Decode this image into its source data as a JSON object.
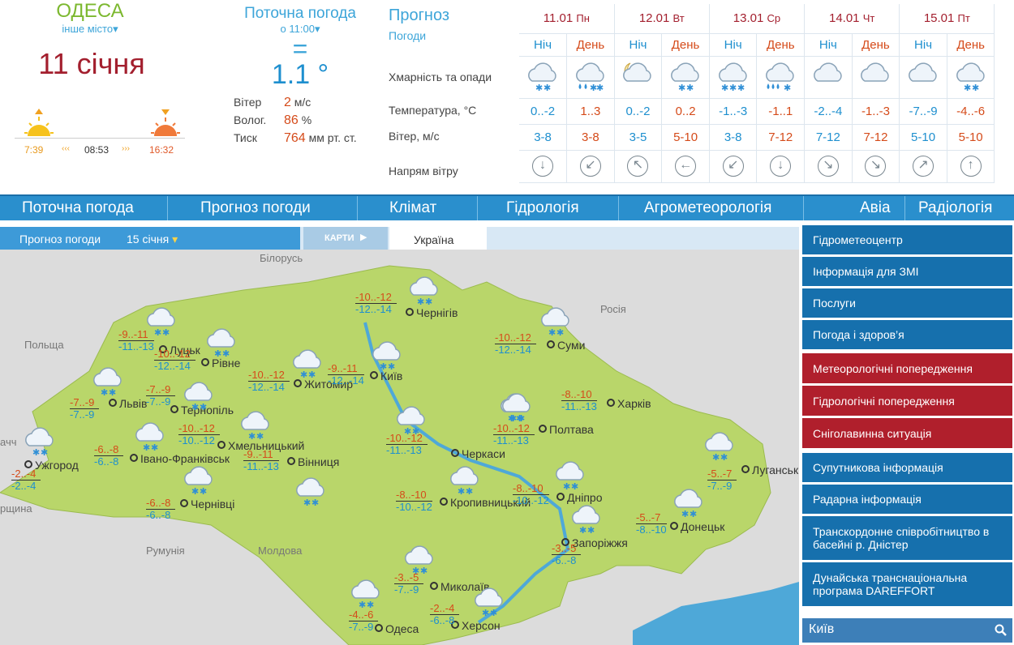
{
  "city": {
    "name": "ОДЕСА",
    "other": "інше місто",
    "date": "11 січня"
  },
  "sun": {
    "rise": "7:39",
    "length": "08:53",
    "set": "16:32"
  },
  "current": {
    "title": "Поточна погода",
    "time": "о 11:00",
    "trend": "=",
    "temp": "1.1 °",
    "wind": {
      "label": "Вітер",
      "value": "2",
      "unit": "м/с"
    },
    "humidity": {
      "label": "Волог.",
      "value": "86",
      "unit": "%"
    },
    "pressure": {
      "label": "Тиск",
      "value": "764",
      "unit": "мм рт. ст."
    }
  },
  "forecast": {
    "title": "Прогноз",
    "subtitle": "Погоди",
    "row_labels": [
      "Хмарність та опади",
      "Температура, °C",
      "Вітер, м/с",
      "Напрям вітру"
    ],
    "night_label": "Ніч",
    "day_label": "День",
    "days": [
      {
        "date": "11.01",
        "dow": "Пн",
        "cols": [
          {
            "temp": "0..-2",
            "wind": "3-8",
            "icon": "cloud-snow-icon",
            "dir": "↓"
          },
          {
            "temp": "1..3",
            "wind": "3-8",
            "icon": "cloud-rain-snow-icon",
            "dir": "↙"
          }
        ]
      },
      {
        "date": "12.01",
        "dow": "Вт",
        "cols": [
          {
            "temp": "0..-2",
            "wind": "3-5",
            "icon": "moon-cloud-icon",
            "dir": "↖"
          },
          {
            "temp": "0..2",
            "wind": "5-10",
            "icon": "cloud-snow-icon",
            "dir": "←"
          }
        ]
      },
      {
        "date": "13.01",
        "dow": "Ср",
        "cols": [
          {
            "temp": "-1..-3",
            "wind": "3-8",
            "icon": "cloud-heavy-snow-icon",
            "dir": "↙"
          },
          {
            "temp": "-1..1",
            "wind": "7-12",
            "icon": "cloud-heavy-rain-snow-icon",
            "dir": "↓"
          }
        ]
      },
      {
        "date": "14.01",
        "dow": "Чт",
        "cols": [
          {
            "temp": "-2..-4",
            "wind": "7-12",
            "icon": "cloud-icon",
            "dir": "↘"
          },
          {
            "temp": "-1..-3",
            "wind": "7-12",
            "icon": "cloud-icon",
            "dir": "↘"
          }
        ]
      },
      {
        "date": "15.01",
        "dow": "Пт",
        "cols": [
          {
            "temp": "-7..-9",
            "wind": "5-10",
            "icon": "cloud-icon",
            "dir": "↗"
          },
          {
            "temp": "-4..-6",
            "wind": "5-10",
            "icon": "cloud-snow-icon",
            "dir": "↑"
          }
        ]
      }
    ]
  },
  "nav": [
    "Поточна погода",
    "Прогноз погоди",
    "Клімат",
    "Гідрологія",
    "Агрометеорологія",
    "Авіа",
    "Радіологія"
  ],
  "tabs": {
    "forecast_label": "Прогноз погоди",
    "forecast_date": "15 січня",
    "maps": "КАРТИ",
    "region": "Україна"
  },
  "map": {
    "countries": [
      {
        "name": "Білорусь"
      },
      {
        "name": "Росія"
      },
      {
        "name": "Польща"
      },
      {
        "name": "Румунія"
      },
      {
        "name": "Молдова"
      },
      {
        "name": "ачч"
      },
      {
        "name": "рщина"
      }
    ],
    "cities": [
      {
        "name": "Луцьк",
        "night": "-9..-11",
        "day": "-11..-13"
      },
      {
        "name": "Рівне",
        "night": "-10..-12",
        "day": "-12..-14"
      },
      {
        "name": "Львів",
        "night": "-7..-9",
        "day": "-7..-9"
      },
      {
        "name": "Тернопіль",
        "night": "-7..-9",
        "day": "-7..-9"
      },
      {
        "name": "Ужгород",
        "night": "-2..-4",
        "day": "-2..-4"
      },
      {
        "name": "Івано-Франківськ",
        "night": "-6..-8",
        "day": "-6..-8"
      },
      {
        "name": "Чернівці",
        "night": "-6..-8",
        "day": "-6..-8"
      },
      {
        "name": "Хмельницький",
        "night": "-10..-12",
        "day": "-10..-12"
      },
      {
        "name": "Вінниця",
        "night": "-9..-11",
        "day": "-11..-13"
      },
      {
        "name": "Житомир",
        "night": "-10..-12",
        "day": "-12..-14"
      },
      {
        "name": "Київ",
        "night": "-9..-11",
        "day": "-12..-14"
      },
      {
        "name": "Чернігів",
        "night": "-10..-12",
        "day": "-12..-14"
      },
      {
        "name": "Суми",
        "night": "-10..-12",
        "day": "-12..-14"
      },
      {
        "name": "Харків",
        "night": "-8..-10",
        "day": "-11..-13"
      },
      {
        "name": "Полтава",
        "night": "-10..-12",
        "day": "-11..-13"
      },
      {
        "name": "Черкаси",
        "night": "-10..-12",
        "day": "-11..-13"
      },
      {
        "name": "Кропивницький",
        "night": "-8..-10",
        "day": "-10..-12"
      },
      {
        "name": "Дніпро",
        "night": "-8..-10",
        "day": "-10..-12"
      },
      {
        "name": "Луганськ",
        "night": "-5..-7",
        "day": "-7..-9"
      },
      {
        "name": "Донецьк",
        "night": "-5..-7",
        "day": "-8..-10"
      },
      {
        "name": "Запоріжжя",
        "night": "-3..-5",
        "day": "-6..-8"
      },
      {
        "name": "Миколаїв",
        "night": "-3..-5",
        "day": "-7..-9"
      },
      {
        "name": "Херсон",
        "night": "-2..-4",
        "day": "-6..-8"
      },
      {
        "name": "Одеса",
        "night": "-4..-6",
        "day": "-7..-9"
      }
    ]
  },
  "sidebar": [
    {
      "label": "Гідрометеоцентр",
      "color": "b"
    },
    {
      "label": "Інформація для ЗМІ",
      "color": "b"
    },
    {
      "label": "Послуги",
      "color": "b"
    },
    {
      "label": "Погода і здоров’я",
      "color": "b"
    },
    {
      "label": "Метеорологічні попередження",
      "color": "r"
    },
    {
      "label": "Гідрологічні попередження",
      "color": "r"
    },
    {
      "label": "Сніголавинна ситуація",
      "color": "r"
    },
    {
      "label": "Супутникова інформація",
      "color": "b"
    },
    {
      "label": "Радарна інформація",
      "color": "b"
    },
    {
      "label": "Транскордонне співробітництво в басейні р. Дністер",
      "color": "b"
    },
    {
      "label": "Дунайська транснаціональна програма DAREFFORT",
      "color": "b"
    }
  ],
  "search": {
    "city": "Київ"
  },
  "colors": {
    "accent": "#3da5d9",
    "nav": "#2a8fcd",
    "warn": "#b01f2c",
    "side": "#1670ad",
    "map_land": "#b9d66a",
    "date_red": "#a31f2e"
  }
}
